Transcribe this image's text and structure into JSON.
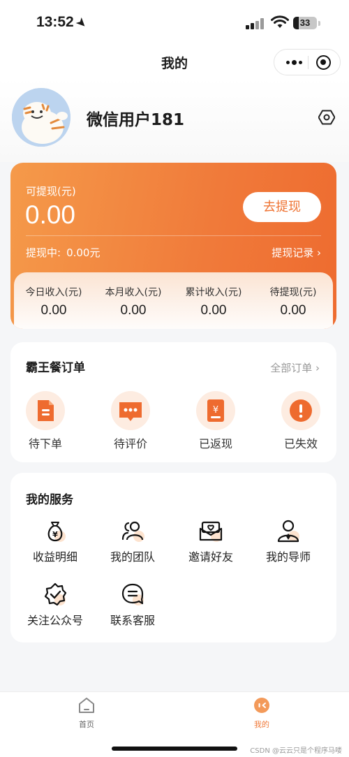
{
  "status_bar": {
    "time": "13:52",
    "battery": "33"
  },
  "nav": {
    "title": "我的"
  },
  "user": {
    "name": "微信用户181"
  },
  "earnings": {
    "withdrawable_label": "可提现(元)",
    "withdrawable_amount": "0.00",
    "withdraw_button": "去提现",
    "pending_label": "提现中:",
    "pending_value": "0.00元",
    "record_link": "提现记录 ›",
    "stats": [
      {
        "label": "今日收入(元)",
        "value": "0.00"
      },
      {
        "label": "本月收入(元)",
        "value": "0.00"
      },
      {
        "label": "累计收入(元)",
        "value": "0.00"
      },
      {
        "label": "待提现(元)",
        "value": "0.00"
      }
    ]
  },
  "orders": {
    "title": "霸王餐订单",
    "all_link": "全部订单 ›",
    "items": [
      {
        "label": "待下单",
        "icon": "document-icon"
      },
      {
        "label": "待评价",
        "icon": "chat-bubble-icon"
      },
      {
        "label": "已返现",
        "icon": "yen-receipt-icon"
      },
      {
        "label": "已失效",
        "icon": "alert-icon"
      }
    ]
  },
  "services": {
    "title": "我的服务",
    "items": [
      {
        "label": "收益明细",
        "icon": "money-bag-icon"
      },
      {
        "label": "我的团队",
        "icon": "team-icon"
      },
      {
        "label": "邀请好友",
        "icon": "invite-mail-icon"
      },
      {
        "label": "我的导师",
        "icon": "mentor-icon"
      },
      {
        "label": "关注公众号",
        "icon": "verified-badge-icon"
      },
      {
        "label": "联系客服",
        "icon": "customer-service-icon"
      }
    ]
  },
  "tabbar": {
    "items": [
      {
        "label": "首页",
        "icon": "home-icon"
      },
      {
        "label": "我的",
        "icon": "profile-icon"
      }
    ],
    "active_color": "#f07a3a"
  },
  "watermark": "CSDN @云云只是个程序马喽",
  "colors": {
    "accent": "#f07a3a",
    "background": "#f5f6f8"
  }
}
